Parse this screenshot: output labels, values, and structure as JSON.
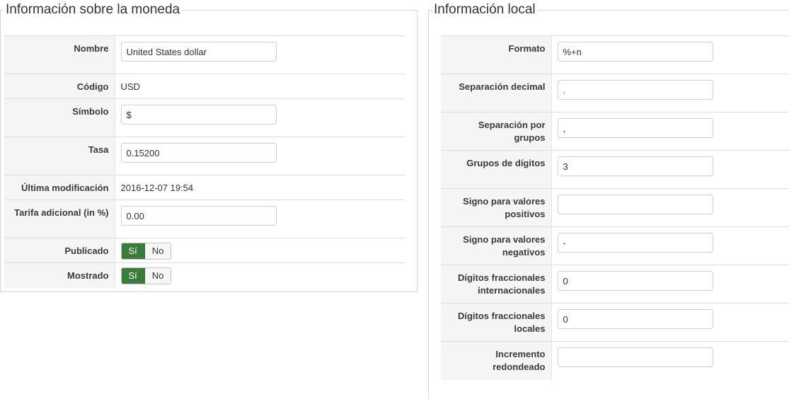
{
  "currency_panel": {
    "title": "Información sobre la moneda",
    "rows": {
      "name": {
        "label": "Nombre",
        "value": "United States dollar"
      },
      "code": {
        "label": "Código",
        "value": "USD"
      },
      "symbol": {
        "label": "Símbolo",
        "value": "$"
      },
      "rate": {
        "label": "Tasa",
        "value": "0.15200"
      },
      "last_modified": {
        "label": "Última modificación",
        "value": "2016-12-07 19:54"
      },
      "extra_fee": {
        "label": "Tarifa adicional (in %)",
        "value": "0.00"
      },
      "published": {
        "label": "Publicado",
        "yes": "Sí",
        "no": "No",
        "selected": "yes"
      },
      "shown": {
        "label": "Mostrado",
        "yes": "Sí",
        "no": "No",
        "selected": "yes"
      }
    }
  },
  "locale_panel": {
    "title": "Información local",
    "rows": {
      "format": {
        "label": "Formato",
        "value": "%+n"
      },
      "decimal_sep": {
        "label": "Separación decimal",
        "value": "."
      },
      "group_sep": {
        "label": "Separación por grupos",
        "value": ","
      },
      "group_digits": {
        "label": "Grupos de dígitos",
        "value": "3"
      },
      "pos_sign": {
        "label": "Signo para valores positivos",
        "value": ""
      },
      "neg_sign": {
        "label": "Signo para valores negativos",
        "value": "-"
      },
      "intl_frac": {
        "label": "Dígitos fraccionales internacionales",
        "value": "0"
      },
      "local_frac": {
        "label": "Dígitos fraccionales locales",
        "value": "0"
      },
      "rounding": {
        "label": "Incremento redondeado",
        "value": ""
      }
    }
  },
  "colors": {
    "toggle_active": "#3a7d3a",
    "label_bg": "#f5f5f5",
    "border": "#d6d6d6"
  }
}
